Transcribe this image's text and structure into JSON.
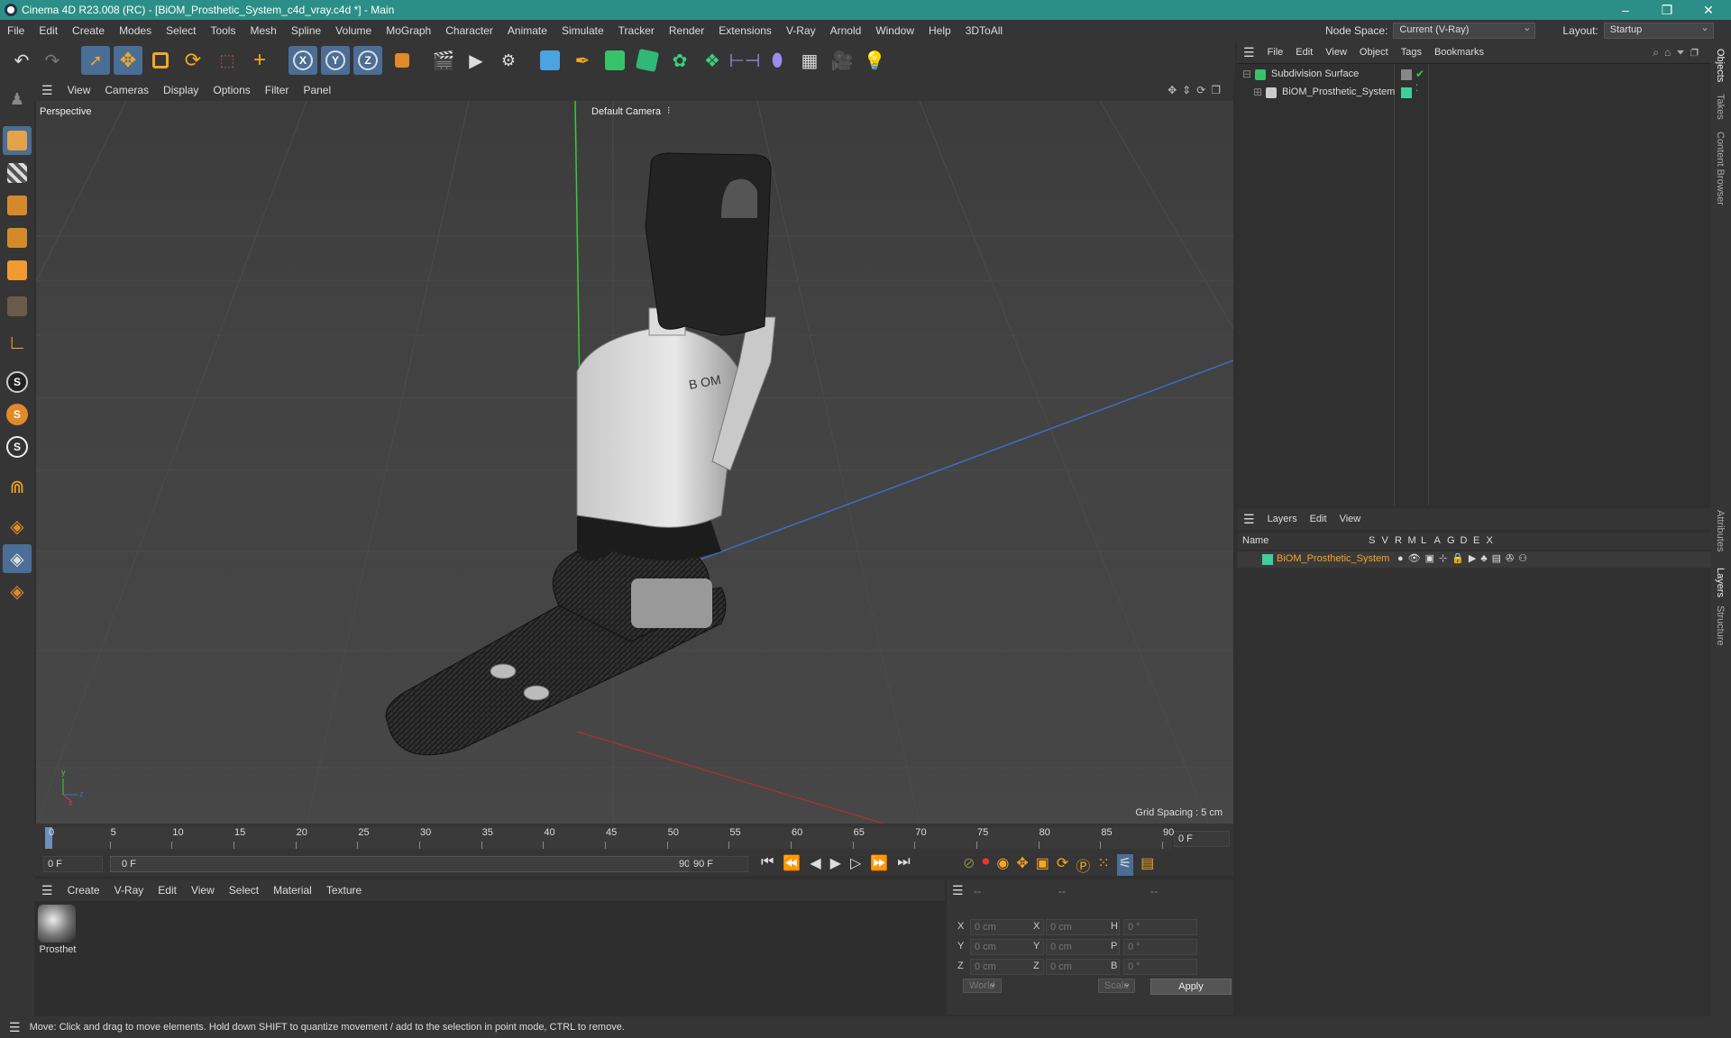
{
  "window": {
    "title": "Cinema 4D R23.008 (RC) - [BiOM_Prosthetic_System_c4d_vray.c4d *] - Main",
    "minimize": "–",
    "restore": "❐",
    "close": "✕"
  },
  "menu": {
    "items": [
      "File",
      "Edit",
      "Create",
      "Modes",
      "Select",
      "Tools",
      "Mesh",
      "Spline",
      "Volume",
      "MoGraph",
      "Character",
      "Animate",
      "Simulate",
      "Tracker",
      "Render",
      "Extensions",
      "V-Ray",
      "Arnold",
      "Window",
      "Help",
      "3DToAll"
    ],
    "node_space_label": "Node Space:",
    "node_space_value": "Current (V-Ray)",
    "layout_label": "Layout:",
    "layout_value": "Startup"
  },
  "viewport": {
    "menu": [
      "View",
      "Cameras",
      "Display",
      "Options",
      "Filter",
      "Panel"
    ],
    "view_name": "Perspective",
    "camera": "Default Camera",
    "camera_icon": "camera-icon",
    "grid_spacing": "Grid Spacing : 5 cm",
    "axis_y": "y",
    "axis_z": "z",
    "axis_x": "x"
  },
  "timeline": {
    "ticks": [
      "0",
      "5",
      "10",
      "15",
      "20",
      "25",
      "30",
      "35",
      "40",
      "45",
      "50",
      "55",
      "60",
      "65",
      "70",
      "75",
      "80",
      "85",
      "90"
    ],
    "frame_display": "0 F"
  },
  "transport": {
    "start": "0 F",
    "range_start": "0 F",
    "range_end": "90 F",
    "end": "90 F"
  },
  "materials": {
    "menu": [
      "Create",
      "V-Ray",
      "Edit",
      "View",
      "Select",
      "Material",
      "Texture"
    ],
    "items": [
      {
        "name": "Prosthet"
      }
    ]
  },
  "coords": {
    "header": [
      "--",
      "--",
      "--"
    ],
    "rows": [
      {
        "a": "X",
        "v1": "0 cm",
        "b": "X",
        "v2": "0 cm",
        "c": "H",
        "v3": "0 °"
      },
      {
        "a": "Y",
        "v1": "0 cm",
        "b": "Y",
        "v2": "0 cm",
        "c": "P",
        "v3": "0 °"
      },
      {
        "a": "Z",
        "v1": "0 cm",
        "b": "Z",
        "v2": "0 cm",
        "c": "B",
        "v3": "0 °"
      }
    ],
    "world": "World",
    "scale": "Scale",
    "apply": "Apply"
  },
  "objects": {
    "menu": [
      "File",
      "Edit",
      "View",
      "Object",
      "Tags",
      "Bookmarks"
    ],
    "items": [
      {
        "name": "Subdivision Surface"
      },
      {
        "name": "BiOM_Prosthetic_System"
      }
    ]
  },
  "layers": {
    "menu": [
      "Layers",
      "Edit",
      "View"
    ],
    "columns": {
      "name": "Name",
      "flags": [
        "S",
        "V",
        "R",
        "M",
        "L",
        "A",
        "G",
        "D",
        "E",
        "X"
      ]
    },
    "items": [
      {
        "name": "BiOM_Prosthetic_System",
        "color": "#3ecf9a"
      }
    ]
  },
  "side_tabs": [
    "Objects",
    "Takes",
    "Content Browser",
    "Attributes",
    "Layers",
    "Structure"
  ],
  "status": "Move: Click and drag to move elements. Hold down SHIFT to quantize movement / add to the selection in point mode, CTRL to remove."
}
